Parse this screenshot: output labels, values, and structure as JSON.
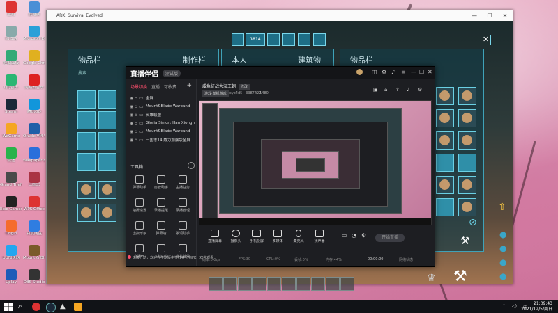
{
  "desktop": {
    "icons": [
      {
        "label": "应用",
        "color": "#d33"
      },
      {
        "label": "此电脑",
        "color": "#4a8fd6"
      },
      {
        "label": "回收站",
        "color": "#8aa"
      },
      {
        "label": "Microsoft Edge",
        "color": "#2aa0d8"
      },
      {
        "label": "控制面板",
        "color": "#3a7"
      },
      {
        "label": "Google Chrome",
        "color": "#e0b020"
      },
      {
        "label": "QQ音乐",
        "color": "#2bb673"
      },
      {
        "label": "网易云音乐",
        "color": "#d22"
      },
      {
        "label": "Steam",
        "color": "#1b2838"
      },
      {
        "label": "腾讯QQ",
        "color": "#1296db"
      },
      {
        "label": "WeGame",
        "color": "#f5a623"
      },
      {
        "label": "Oracle VM VirtualBox",
        "color": "#1f5fa8"
      },
      {
        "label": "微信",
        "color": "#29b34b"
      },
      {
        "label": "Wallpaper Engine",
        "color": "#2a6fdb"
      },
      {
        "label": "Grand Theft Auto V",
        "color": "#4a4a4a"
      },
      {
        "label": "三国志",
        "color": "#a34"
      },
      {
        "label": "Epic Games",
        "color": "#222"
      },
      {
        "label": "WPS Office",
        "color": "#d33"
      },
      {
        "label": "Origin",
        "color": "#f56c2d"
      },
      {
        "label": "百度网盘",
        "color": "#2f7de1"
      },
      {
        "label": "UU加速器",
        "color": "#23a6f0"
      },
      {
        "label": "Mount & Blade",
        "color": "#7a5a2a"
      },
      {
        "label": "Uplay",
        "color": "#1e5bb8"
      },
      {
        "label": "OBS Studio",
        "color": "#333"
      }
    ]
  },
  "game_window": {
    "title": "ARK: Survival Evolved",
    "top_counter": "1814",
    "tabs": {
      "left": "物品栏",
      "crafting": "制作栏",
      "self": "本人",
      "structures": "建筑物",
      "right": "物品栏"
    },
    "search_placeholder": "搜索"
  },
  "stream_app": {
    "logo": "直播伴侣",
    "version": "测试版",
    "tabs": [
      "场景切换",
      "直播",
      "可收费"
    ],
    "scenes": [
      "全屏 1",
      "Mount&Blade Warband",
      "英雄联盟",
      "Gloria Sinica: Han Xiongnu Wars",
      "Mount&Blade Warband",
      "三国志14 威力加强版全屏"
    ],
    "tools_header": "工具箱",
    "tools": [
      "弹幕助手",
      "房管助手",
      "主播任务",
      "拍摄设置",
      "录播提醒",
      "录播管理",
      "虚拟形象",
      "弹幕墙",
      "歌词助手",
      "直播PK",
      "下载中心",
      "送礼特效"
    ],
    "tip": "无障行动，欢迎在手动版中签收等礼物PK，欢迎观看",
    "room": {
      "title": "咸鱼征战大汉王朝",
      "edit": "修改",
      "tag": "游戏·单机游戏",
      "id": "cyo4d5",
      "fans": "3387422",
      "hot": "1480"
    },
    "controls": [
      "直播屏幕",
      "摄像头",
      "手机投屏",
      "多媒体",
      "麦克风",
      "扬声器"
    ],
    "go_live": "开始直播",
    "status": {
      "bitrate": "码率:0Kb/s",
      "fps": "FPS:30",
      "cpu": "CPU:0%",
      "drop": "丢帧:0%",
      "mem": "内存:44%",
      "time": "00:00:00",
      "net": "网络状态"
    }
  },
  "taskbar": {
    "time": "21:09:43",
    "date": "2021/12/5/周日"
  }
}
